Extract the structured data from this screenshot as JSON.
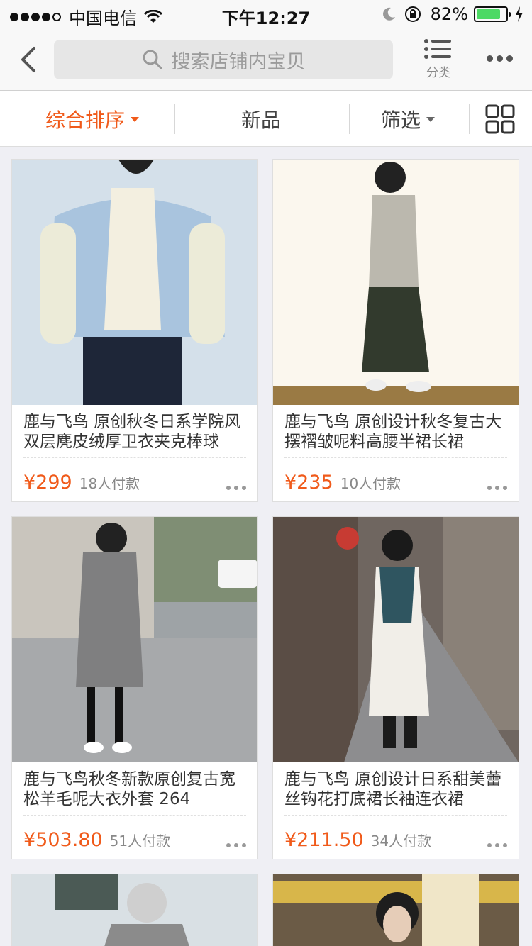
{
  "status_bar": {
    "carrier": "中国电信",
    "time": "下午12:27",
    "battery": "82%",
    "battery_level": 0.82
  },
  "nav": {
    "search_placeholder": "搜索店铺内宝贝",
    "category_label": "分类"
  },
  "sort_bar": {
    "items": [
      "综合排序",
      "新品",
      "筛选"
    ]
  },
  "colors": {
    "accent": "#f05a1a"
  },
  "products": [
    {
      "title": "鹿与飞鸟 原创秋冬日系学院风双层麂皮绒厚卫衣夹克棒球",
      "price": "¥299",
      "sold": "18人付款"
    },
    {
      "title": "鹿与飞鸟 原创设计秋冬复古大摆褶皱呢料高腰半裙长裙",
      "price": "¥235",
      "sold": "10人付款"
    },
    {
      "title": "鹿与飞鸟秋冬新款原创复古宽松羊毛呢大衣外套 264",
      "price": "¥503.80",
      "sold": "51人付款"
    },
    {
      "title": "鹿与飞鸟 原创设计日系甜美蕾丝钩花打底裙长袖连衣裙",
      "price": "¥211.50",
      "sold": "34人付款"
    }
  ]
}
